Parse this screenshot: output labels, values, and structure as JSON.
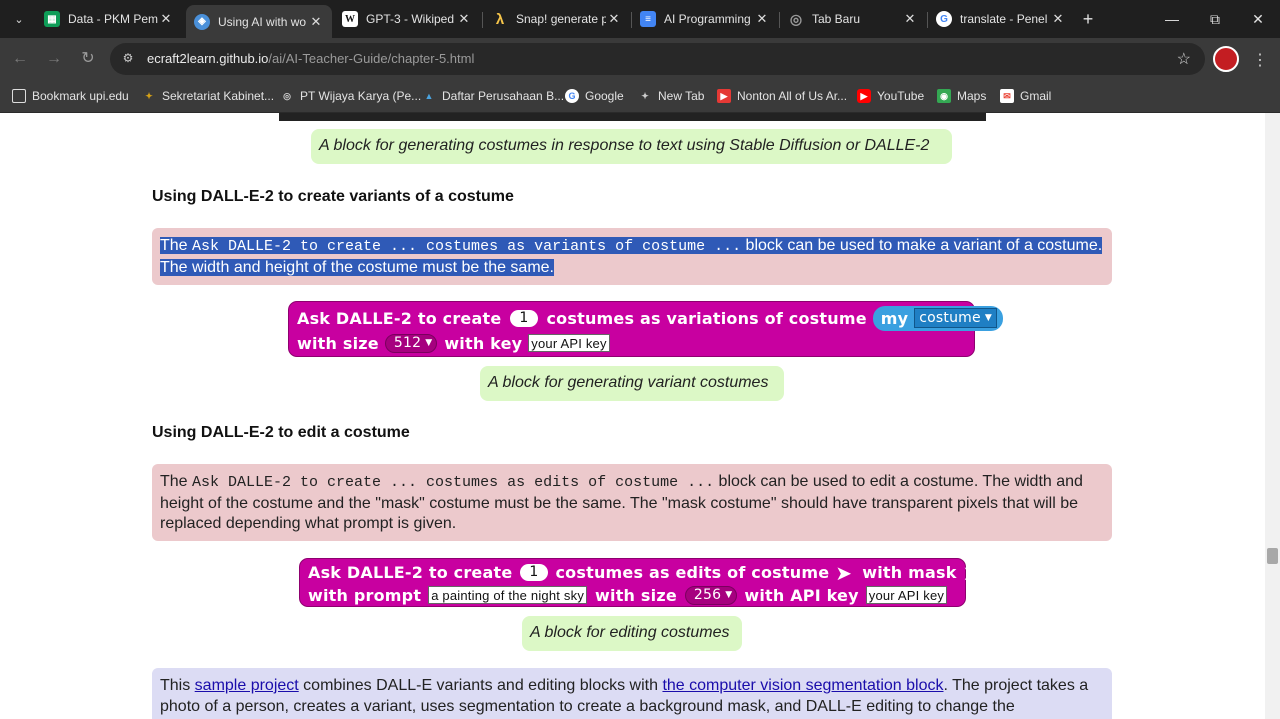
{
  "browser": {
    "tabs": [
      {
        "title": "Data - PKM Pem",
        "icon": "sheets-icon",
        "color": "#0f9d58"
      },
      {
        "title": "Using AI with wo",
        "icon": "site-icon",
        "color": "#4a90d9",
        "active": true
      },
      {
        "title": "GPT-3 - Wikiped",
        "icon": "wikipedia-icon",
        "color": "#ffffff"
      },
      {
        "title": "Snap! generate p",
        "icon": "snap-icon",
        "color": "#f6c54a"
      },
      {
        "title": "AI Programming",
        "icon": "docs-icon",
        "color": "#4285f4"
      },
      {
        "title": "Tab Baru",
        "icon": "chrome-icon",
        "color": "#888888"
      },
      {
        "title": "translate - Penel",
        "icon": "google-icon",
        "color": "#ffffff"
      }
    ],
    "url_host": "ecraft2learn.github.io",
    "url_path": "/ai/AI-Teacher-Guide/chapter-5.html",
    "bookmarks": [
      {
        "label": "Bookmark upi.edu",
        "icon": "folder-icon"
      },
      {
        "label": "Sekretariat Kabinet...",
        "icon": "garuda-icon"
      },
      {
        "label": "PT Wijaya Karya (Pe...",
        "icon": "globe-icon"
      },
      {
        "label": "Daftar Perusahaan B...",
        "icon": "site-icon"
      },
      {
        "label": "Google",
        "icon": "google-icon"
      },
      {
        "label": "New Tab",
        "icon": "newtab-icon"
      },
      {
        "label": "Nonton All of Us Ar...",
        "icon": "video-icon"
      },
      {
        "label": "YouTube",
        "icon": "youtube-icon"
      },
      {
        "label": "Maps",
        "icon": "maps-icon"
      },
      {
        "label": "Gmail",
        "icon": "gmail-icon"
      }
    ]
  },
  "page": {
    "caption_generate": "A block for generating costumes in response to text using Stable Diffusion or DALLE-2",
    "heading_variants": "Using DALL-E-2 to create variants of a costume",
    "variants_note": {
      "pre": "The ",
      "code": "Ask DALLE-2 to create ... costumes as variants of costume ...",
      "post": " block can be used to make a variant of a costume. The width and height of the costume must be the same."
    },
    "variant_block": {
      "part1": "Ask DALLE-2 to create",
      "count": "1",
      "part2": "costumes as variations of costume",
      "my": "my",
      "costume": "costume",
      "with_size": "with size",
      "size": "512",
      "with_key": "with key",
      "key": "your API key"
    },
    "caption_variant": "A block for generating variant costumes",
    "heading_edit": "Using DALL-E-2 to edit a costume",
    "edit_note": {
      "pre": "The ",
      "code": "Ask DALLE-2 to create ... costumes as edits of costume ...",
      "post": " block can be used to edit a costume. The width and height of the costume and the \"mask\" costume must be the same. The \"mask costume\" should have transparent pixels that will be replaced depending what prompt is given."
    },
    "edit_block": {
      "part1": "Ask DALLE-2 to create",
      "count": "1",
      "part2": "costumes as edits of costume",
      "with_mask": "with mask",
      "with_prompt": "with prompt",
      "prompt": "a painting of the night sky",
      "with_size": "with size",
      "size": "256",
      "with_key": "with API key",
      "key": "your API key"
    },
    "caption_edit": "A block for editing costumes",
    "sample_note": {
      "pre": "This ",
      "link1": "sample project",
      "mid": " combines DALL-E variants and editing blocks with ",
      "link2": "the computer vision segmentation block",
      "post": ". The project takes a photo of a person, creates a variant, uses segmentation to create a background mask, and DALL-E editing to change the"
    }
  }
}
